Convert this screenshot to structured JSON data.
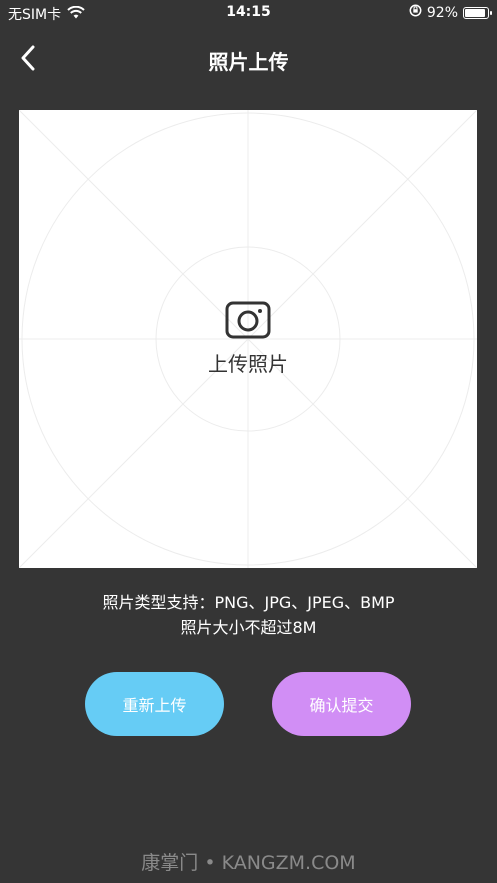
{
  "status_bar": {
    "carrier": "无SIM卡",
    "time": "14:15",
    "battery_percent": "92%",
    "battery_level": 0.92
  },
  "nav": {
    "title": "照片上传"
  },
  "upload": {
    "label": "上传照片"
  },
  "info": {
    "line1": "照片类型支持：PNG、JPG、JPEG、BMP",
    "line2": "照片大小不超过8M"
  },
  "buttons": {
    "reupload": "重新上传",
    "confirm": "确认提交"
  },
  "watermark": "康掌门 • KANGZM.COM",
  "colors": {
    "background": "#353535",
    "reupload_button": "#66ccf5",
    "confirm_button": "#d18ef5"
  }
}
